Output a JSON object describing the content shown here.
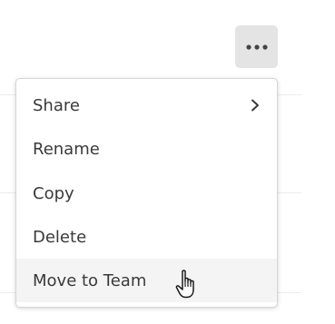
{
  "more_button": {
    "icon": "more-horizontal-icon",
    "color": "#444444"
  },
  "context_menu": {
    "items": [
      {
        "label": "Share",
        "has_submenu": true,
        "submenu_icon": "chevron-right-icon"
      },
      {
        "label": "Rename",
        "has_submenu": false
      },
      {
        "label": "Copy",
        "has_submenu": false
      },
      {
        "label": "Delete",
        "has_submenu": false
      },
      {
        "label": "Move to Team",
        "has_submenu": false,
        "hovered": true
      }
    ]
  },
  "cursor": {
    "icon": "hand-pointer-icon"
  },
  "colors": {
    "menu_text": "#3a3a3a",
    "hover_bg": "#f4f4f4",
    "button_bg": "#e4e4e4"
  }
}
